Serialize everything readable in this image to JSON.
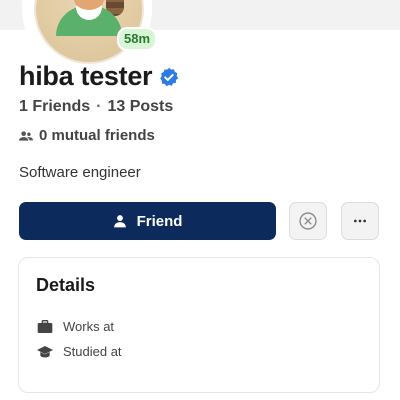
{
  "profile": {
    "name": "hiba tester",
    "time_badge": "58m",
    "friends": "1 Friends",
    "separator": "·",
    "posts": "13 Posts",
    "mutual": "0 mutual friends",
    "bio": "Software engineer"
  },
  "actions": {
    "friend_label": "Friend",
    "reject_icon": "circle-x-icon",
    "more_icon": "ellipsis-icon"
  },
  "details": {
    "title": "Details",
    "items": [
      {
        "icon": "briefcase-icon",
        "label": "Works at"
      },
      {
        "icon": "graduation-cap-icon",
        "label": "Studied at"
      }
    ]
  },
  "colors": {
    "primary_button": "#0d2a5c",
    "verified": "#2f7be6",
    "time_badge_bg": "#d9f5d8",
    "time_badge_text": "#2a7a2a"
  }
}
